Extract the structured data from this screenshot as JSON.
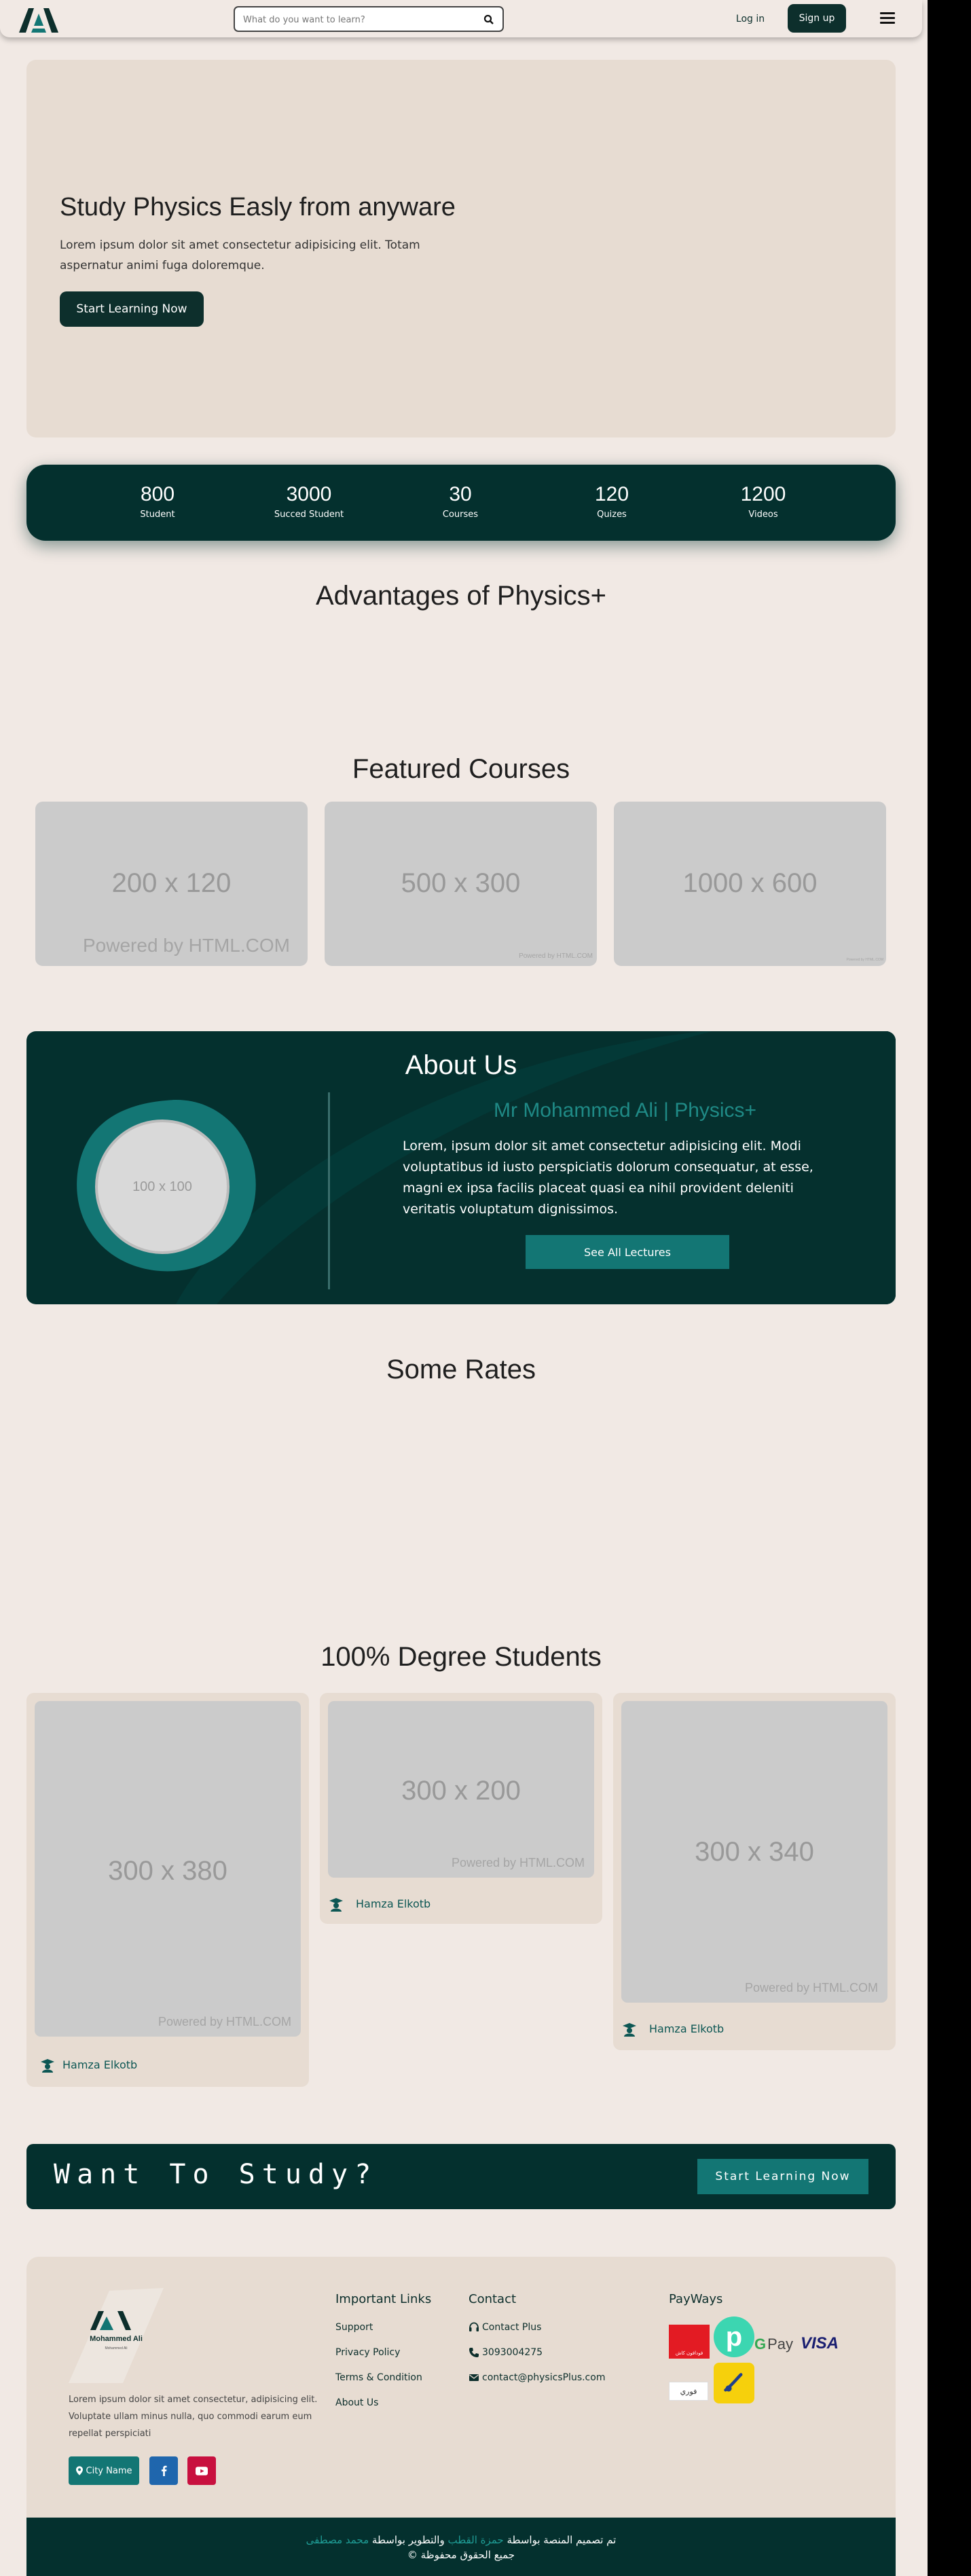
{
  "brand": {
    "logo_text": "Mohammed Ali",
    "logo_sub": "Mohammed Ali"
  },
  "nav": {
    "search_placeholder": "What do you want to learn?",
    "login": "Log in",
    "signup": "Sign up",
    "icons": [
      "search-icon",
      "hamburger-menu-icon"
    ]
  },
  "hero": {
    "title": "Study Physics Easly from anyware",
    "text": "Lorem ipsum dolor sit amet consectetur adipisicing elit. Totam aspernatur animi fuga doloremque.",
    "cta": "Start Learning Now"
  },
  "stats": [
    {
      "num": "800",
      "label": "Student"
    },
    {
      "num": "3000",
      "label": "Succed Student"
    },
    {
      "num": "30",
      "label": "Courses"
    },
    {
      "num": "120",
      "label": "Quizes"
    },
    {
      "num": "1200",
      "label": "Videos"
    }
  ],
  "advantages": {
    "title": "Advantages of Physics+"
  },
  "featured": {
    "title": "Featured Courses",
    "cards": [
      {
        "dim": "200 x 120",
        "powered": "Powered by HTML.COM"
      },
      {
        "dim": "500 x 300",
        "powered": "Powered by HTML.COM"
      },
      {
        "dim": "1000 x 600",
        "powered": "Powered by HTML.COM"
      }
    ]
  },
  "about": {
    "title": "About Us",
    "avatar_dim": "100 x 100",
    "name": "Mr Mohammed Ali | Physics+",
    "text": "Lorem, ipsum dolor sit amet consectetur adipisicing elit. Modi voluptatibus id iusto perspiciatis dolorum consequatur, at esse, magni ex ipsa facilis placeat quasi ea nihil provident deleniti veritatis voluptatum dignissimos.",
    "button": "See All Lectures"
  },
  "rates": {
    "title": "Some Rates"
  },
  "degree": {
    "title": "100% Degree Students",
    "cards": [
      {
        "dim": "300 x 380",
        "powered": "Powered by HTML.COM",
        "name": "Hamza Elkotb"
      },
      {
        "dim": "300 x 200",
        "powered": "Powered by HTML.COM",
        "name": "Hamza Elkotb"
      },
      {
        "dim": "300 x 340",
        "powered": "Powered by HTML.COM",
        "name": "Hamza Elkotb"
      }
    ]
  },
  "want": {
    "title": "Want To Study?",
    "button": "Start Learning Now"
  },
  "footer": {
    "about": "Lorem ipsum dolor sit amet consectetur, adipisicing elit. Voluptate ullam minus nulla, quo commodi earum eum repellat perspiciati",
    "city_button": "City Name",
    "social": [
      "facebook-icon",
      "youtube-icon"
    ],
    "links_title": "Important Links",
    "links": [
      "Support",
      "Privacy Policy",
      "Terms & Condition",
      "About Us"
    ],
    "contact_title": "Contact",
    "contacts": [
      "Contact Plus",
      "3093004275",
      "contact@physicsPlus.com"
    ],
    "payways_title": "PayWays",
    "pay_labels": [
      "فودافون كاش",
      "Pay",
      "VISA",
      "فوري"
    ],
    "copy_line1_pre": "تم تصميم المنصة بواسطة",
    "copy_name1": "حمزة القطب",
    "copy_mid": "والتطوير بواسطة",
    "copy_name2": "محمد مصطفى",
    "copy_line2": "جميع الحقوق محفوظة ©"
  },
  "colors": {
    "primary": "#04302e",
    "accent": "#137674",
    "bg": "#f1e9e4",
    "card": "#e7dcd2"
  }
}
